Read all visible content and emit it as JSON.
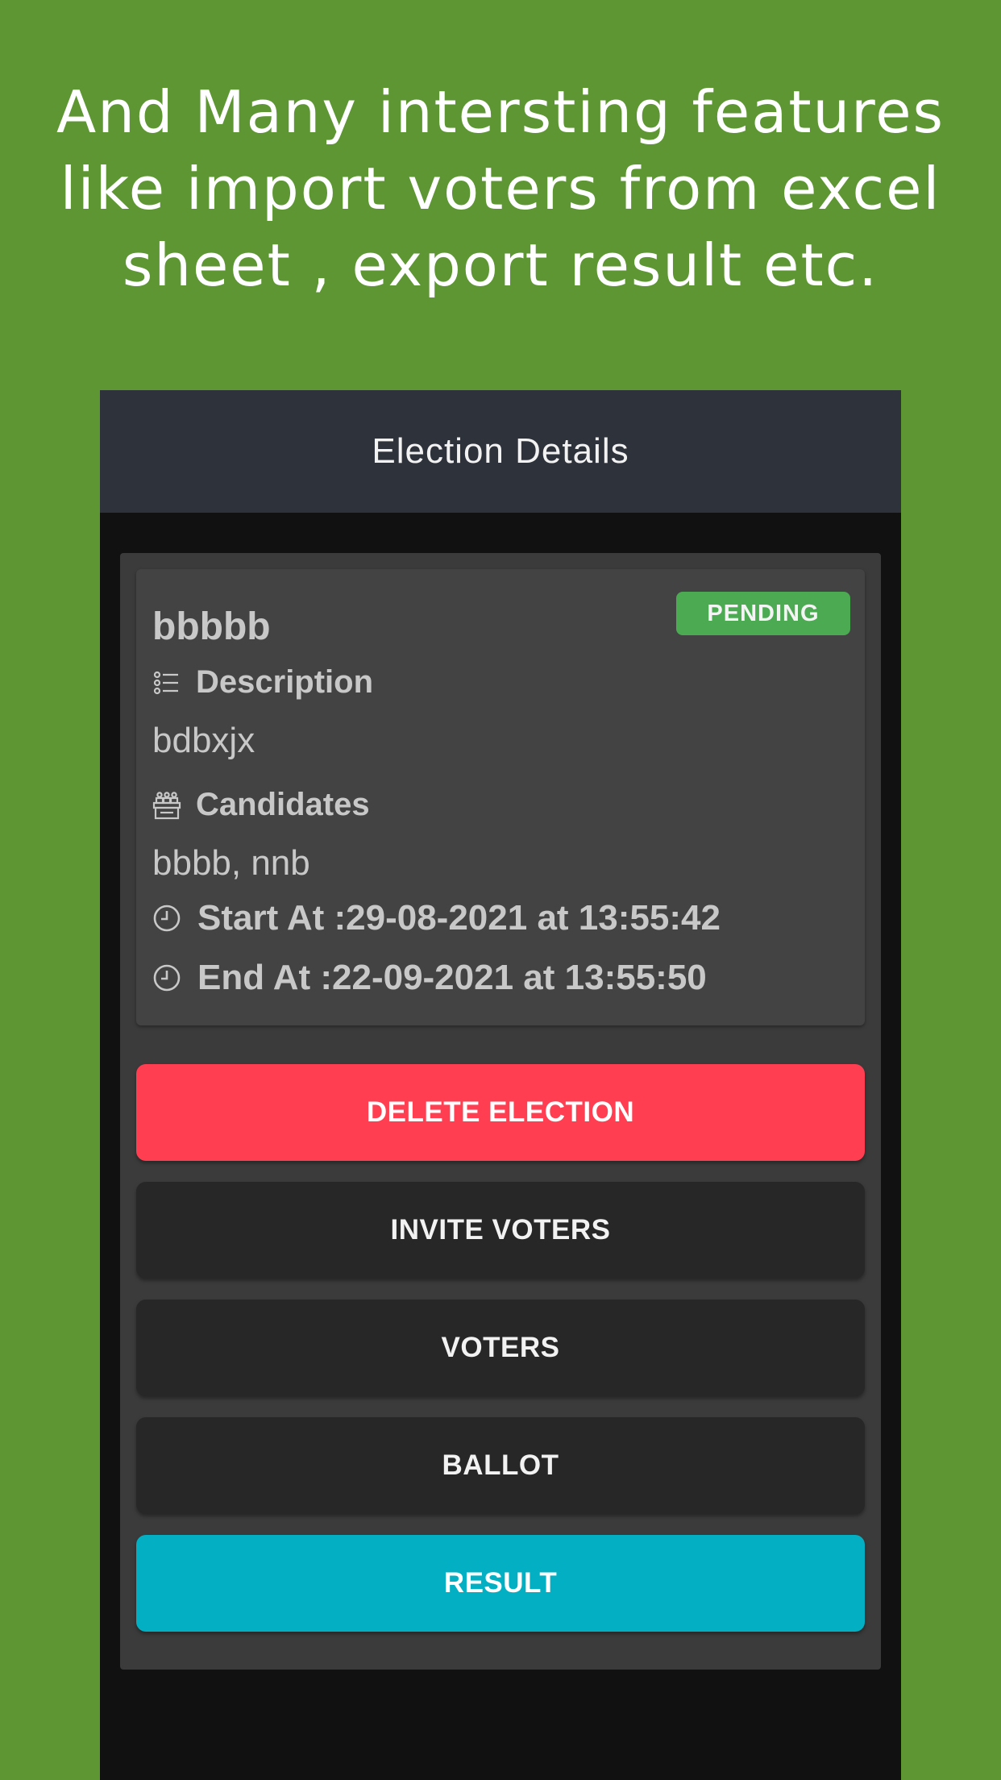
{
  "promo": {
    "lines": [
      "And Many intersting features",
      "like import voters from excel",
      "sheet , export result etc."
    ]
  },
  "app": {
    "title": "Election Details",
    "election": {
      "name": "bbbbb",
      "status": "PENDING",
      "description_label": "Description",
      "description": "bdbxjx",
      "candidates_label": "Candidates",
      "candidates": "bbbb, nnb",
      "start": "Start At :29-08-2021 at 13:55:42",
      "end": "End At :22-09-2021 at 13:55:50"
    },
    "buttons": {
      "delete": "DELETE ELECTION",
      "invite": "INVITE VOTERS",
      "voters": "VOTERS",
      "ballot": "BALLOT",
      "result": "RESULT"
    }
  },
  "colors": {
    "background": "#5e9634",
    "appbar": "#2e323b",
    "status_badge": "#4caa52",
    "danger": "#ff3f51",
    "dark_button": "#272727",
    "info": "#03b0c3"
  },
  "icons": {
    "description": "list-icon",
    "candidates": "ballot-box-icon",
    "start": "clock-icon",
    "end": "clock-icon"
  }
}
